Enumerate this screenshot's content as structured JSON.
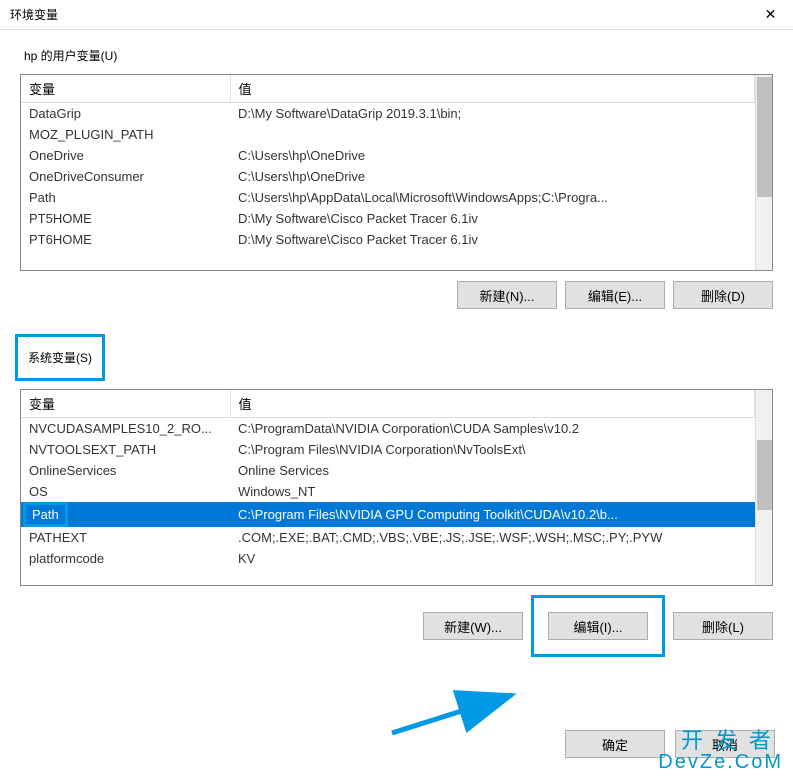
{
  "window": {
    "title": "环境变量"
  },
  "user_section": {
    "label": "hp 的用户变量(U)",
    "headers": {
      "variable": "变量",
      "value": "值"
    },
    "rows": [
      {
        "name": "DataGrip",
        "value": "D:\\My Software\\DataGrip 2019.3.1\\bin;"
      },
      {
        "name": "MOZ_PLUGIN_PATH",
        "value": ""
      },
      {
        "name": "OneDrive",
        "value": "C:\\Users\\hp\\OneDrive"
      },
      {
        "name": "OneDriveConsumer",
        "value": "C:\\Users\\hp\\OneDrive"
      },
      {
        "name": "Path",
        "value": "C:\\Users\\hp\\AppData\\Local\\Microsoft\\WindowsApps;C:\\Progra..."
      },
      {
        "name": "PT5HOME",
        "value": "D:\\My Software\\Cisco Packet Tracer 6.1iv"
      },
      {
        "name": "PT6HOME",
        "value": "D:\\My Software\\Cisco Packet Tracer 6.1iv"
      }
    ],
    "buttons": {
      "new": "新建(N)...",
      "edit": "编辑(E)...",
      "delete": "删除(D)"
    }
  },
  "system_section": {
    "label": "系统变量(S)",
    "headers": {
      "variable": "变量",
      "value": "值"
    },
    "rows": [
      {
        "name": "NVCUDASAMPLES10_2_RO...",
        "value": "C:\\ProgramData\\NVIDIA Corporation\\CUDA Samples\\v10.2"
      },
      {
        "name": "NVTOOLSEXT_PATH",
        "value": "C:\\Program Files\\NVIDIA Corporation\\NvToolsExt\\"
      },
      {
        "name": "OnlineServices",
        "value": "Online Services"
      },
      {
        "name": "OS",
        "value": "Windows_NT"
      },
      {
        "name": "Path",
        "value": "C:\\Program Files\\NVIDIA GPU Computing Toolkit\\CUDA\\v10.2\\b...",
        "selected": true
      },
      {
        "name": "PATHEXT",
        "value": ".COM;.EXE;.BAT;.CMD;.VBS;.VBE;.JS;.JSE;.WSF;.WSH;.MSC;.PY;.PYW"
      },
      {
        "name": "platformcode",
        "value": "KV"
      }
    ],
    "buttons": {
      "new": "新建(W)...",
      "edit": "编辑(I)...",
      "delete": "删除(L)"
    }
  },
  "dialog_buttons": {
    "ok": "确定",
    "cancel": "取消"
  },
  "watermark": {
    "line1": "开发者",
    "line2": "DevZe.CoM"
  }
}
